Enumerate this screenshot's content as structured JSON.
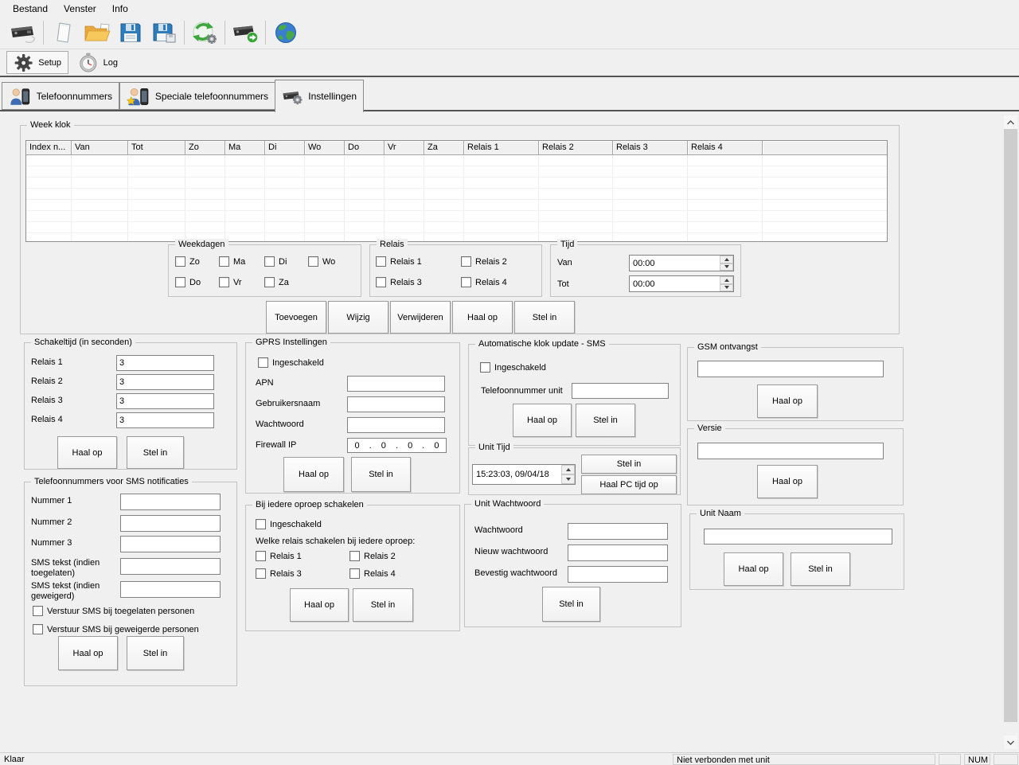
{
  "window": {
    "menu": [
      "Bestand",
      "Venster",
      "Info"
    ],
    "status": {
      "left": "Klaar",
      "connection": "Niet verbonden met unit",
      "num_lock": "NUM"
    }
  },
  "toolbar": {
    "icons": [
      "unit-icon",
      "new-document-icon",
      "open-folder-icon",
      "save-icon",
      "save-as-icon",
      "sync-icon",
      "unit-send-icon",
      "globe-icon"
    ]
  },
  "main_tabs": {
    "setup": "Setup",
    "log": "Log"
  },
  "sub_tabs": {
    "telefoonnummers": "Telefoonnummers",
    "speciale": "Speciale telefoonnummers",
    "instellingen": "Instellingen"
  },
  "week_klok": {
    "title": "Week klok",
    "columns": [
      "Index n...",
      "Van",
      "Tot",
      "Zo",
      "Ma",
      "Di",
      "Wo",
      "Do",
      "Vr",
      "Za",
      "Relais 1",
      "Relais 2",
      "Relais 3",
      "Relais 4",
      ""
    ],
    "rows": [],
    "weekdagen": {
      "title": "Weekdagen",
      "items": [
        "Zo",
        "Ma",
        "Di",
        "Wo",
        "Do",
        "Vr",
        "Za"
      ]
    },
    "relais": {
      "title": "Relais",
      "items": [
        "Relais 1",
        "Relais 2",
        "Relais 3",
        "Relais 4"
      ]
    },
    "tijd": {
      "title": "Tijd",
      "van_label": "Van",
      "van_value": "00:00",
      "tot_label": "Tot",
      "tot_value": "00:00"
    },
    "buttons": {
      "toevoegen": "Toevoegen",
      "wijzig": "Wijzig",
      "verwijderen": "Verwijderen",
      "haal_op": "Haal op",
      "stel_in": "Stel in"
    }
  },
  "schakeltijd": {
    "title": "Schakeltijd (in seconden)",
    "fields": [
      {
        "label": "Relais 1",
        "value": "3"
      },
      {
        "label": "Relais 2",
        "value": "3"
      },
      {
        "label": "Relais 3",
        "value": "3"
      },
      {
        "label": "Relais 4",
        "value": "3"
      }
    ],
    "haal_op": "Haal op",
    "stel_in": "Stel in"
  },
  "gprs": {
    "title": "GPRS Instellingen",
    "ingeschakeld": "Ingeschakeld",
    "apn_label": "APN",
    "apn_value": "",
    "gebruikersnaam_label": "Gebruikersnaam",
    "gebruikersnaam_value": "",
    "wachtwoord_label": "Wachtwoord",
    "wachtwoord_value": "",
    "firewall_label": "Firewall IP",
    "firewall_value": "0 . 0 . 0 . 0",
    "haal_op": "Haal op",
    "stel_in": "Stel in"
  },
  "klok_update": {
    "title": "Automatische klok update - SMS",
    "ingeschakeld": "Ingeschakeld",
    "telefoonnummer_label": "Telefoonnummer unit",
    "telefoonnummer_value": "",
    "haal_op": "Haal op",
    "stel_in": "Stel in"
  },
  "unit_tijd": {
    "title": "Unit Tijd",
    "value": "15:23:03, 09/04/18",
    "stel_in": "Stel in",
    "haal_pc_tijd": "Haal PC tijd op"
  },
  "gsm_ontvangst": {
    "title": "GSM ontvangst",
    "value": "",
    "haal_op": "Haal op"
  },
  "versie": {
    "title": "Versie",
    "value": "",
    "haal_op": "Haal op"
  },
  "unit_naam": {
    "title": "Unit Naam",
    "value": "",
    "haal_op": "Haal op",
    "stel_in": "Stel in"
  },
  "sms_notificaties": {
    "title": "Telefoonnummers voor SMS notificaties",
    "fields": [
      {
        "label": "Nummer 1",
        "value": ""
      },
      {
        "label": "Nummer 2",
        "value": ""
      },
      {
        "label": "Nummer 3",
        "value": ""
      },
      {
        "label": "SMS tekst (indien toegelaten)",
        "value": ""
      },
      {
        "label": "SMS tekst (indien geweigerd)",
        "value": ""
      }
    ],
    "checkbox_toegelaten": "Verstuur SMS bij toegelaten personen",
    "checkbox_geweigerd": "Verstuur SMS bij geweigerde personen",
    "haal_op": "Haal op",
    "stel_in": "Stel in"
  },
  "oproep_schakelen": {
    "title": "Bij iedere oproep schakelen",
    "ingeschakeld": "Ingeschakeld",
    "subtitle": "Welke relais schakelen bij iedere oproep:",
    "relais": [
      "Relais 1",
      "Relais 2",
      "Relais 3",
      "Relais 4"
    ],
    "haal_op": "Haal op",
    "stel_in": "Stel in"
  },
  "unit_wachtwoord": {
    "title": "Unit Wachtwoord",
    "wachtwoord_label": "Wachtwoord",
    "wachtwoord_value": "",
    "nieuw_label": "Nieuw wachtwoord",
    "nieuw_value": "",
    "bevestig_label": "Bevestig wachtwoord",
    "bevestig_value": "",
    "stel_in": "Stel in"
  },
  "colors": {
    "window_bg": "#f0f0f0",
    "tab_divider_dark": "#535353",
    "folder_yellow": "#f7c85c",
    "floppy_blue": "#2e7cba",
    "sync_green": "#3fa53f",
    "globe_blue": "#3a7ed0",
    "person_shirt_blue": "#3f6cb0",
    "star_yellow": "#f5c518"
  }
}
